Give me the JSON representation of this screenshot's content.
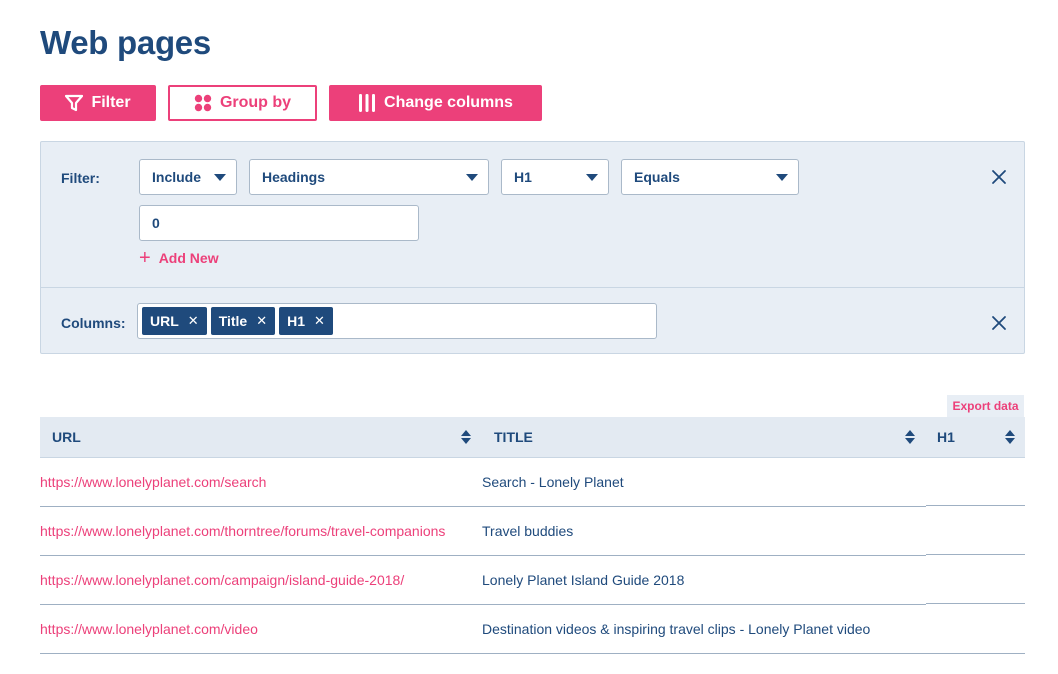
{
  "page": {
    "title": "Web pages"
  },
  "toolbar": {
    "filter_label": "Filter",
    "group_label": "Group by",
    "columns_label": "Change columns"
  },
  "filter_panel": {
    "label": "Filter:",
    "include": "Include",
    "field": "Headings",
    "subfield": "H1",
    "operator": "Equals",
    "value": "0",
    "add_new": "Add New"
  },
  "columns_panel": {
    "label": "Columns:",
    "tags": [
      "URL",
      "Title",
      "H1"
    ]
  },
  "table": {
    "export_label": "Export data",
    "headers": [
      "URL",
      "TITLE",
      "H1"
    ],
    "rows": [
      {
        "url": "https://www.lonelyplanet.com/search",
        "title": "Search - Lonely Planet",
        "h1": ""
      },
      {
        "url": "https://www.lonelyplanet.com/thorntree/forums/travel-companions",
        "title": "Travel buddies",
        "h1": ""
      },
      {
        "url": "https://www.lonelyplanet.com/campaign/island-guide-2018/",
        "title": "Lonely Planet Island Guide 2018",
        "h1": ""
      },
      {
        "url": "https://www.lonelyplanet.com/video",
        "title": "Destination videos & inspiring travel clips - Lonely Planet video",
        "h1": ""
      }
    ]
  },
  "colors": {
    "accent": "#ec407a",
    "primary": "#1f4a7c",
    "panel": "#e8eef5"
  },
  "icons": {
    "filter": "funnel-icon",
    "group": "grid-dots-icon",
    "columns": "columns-icon",
    "close": "close-icon",
    "sort": "sort-icon",
    "add": "plus-icon"
  }
}
